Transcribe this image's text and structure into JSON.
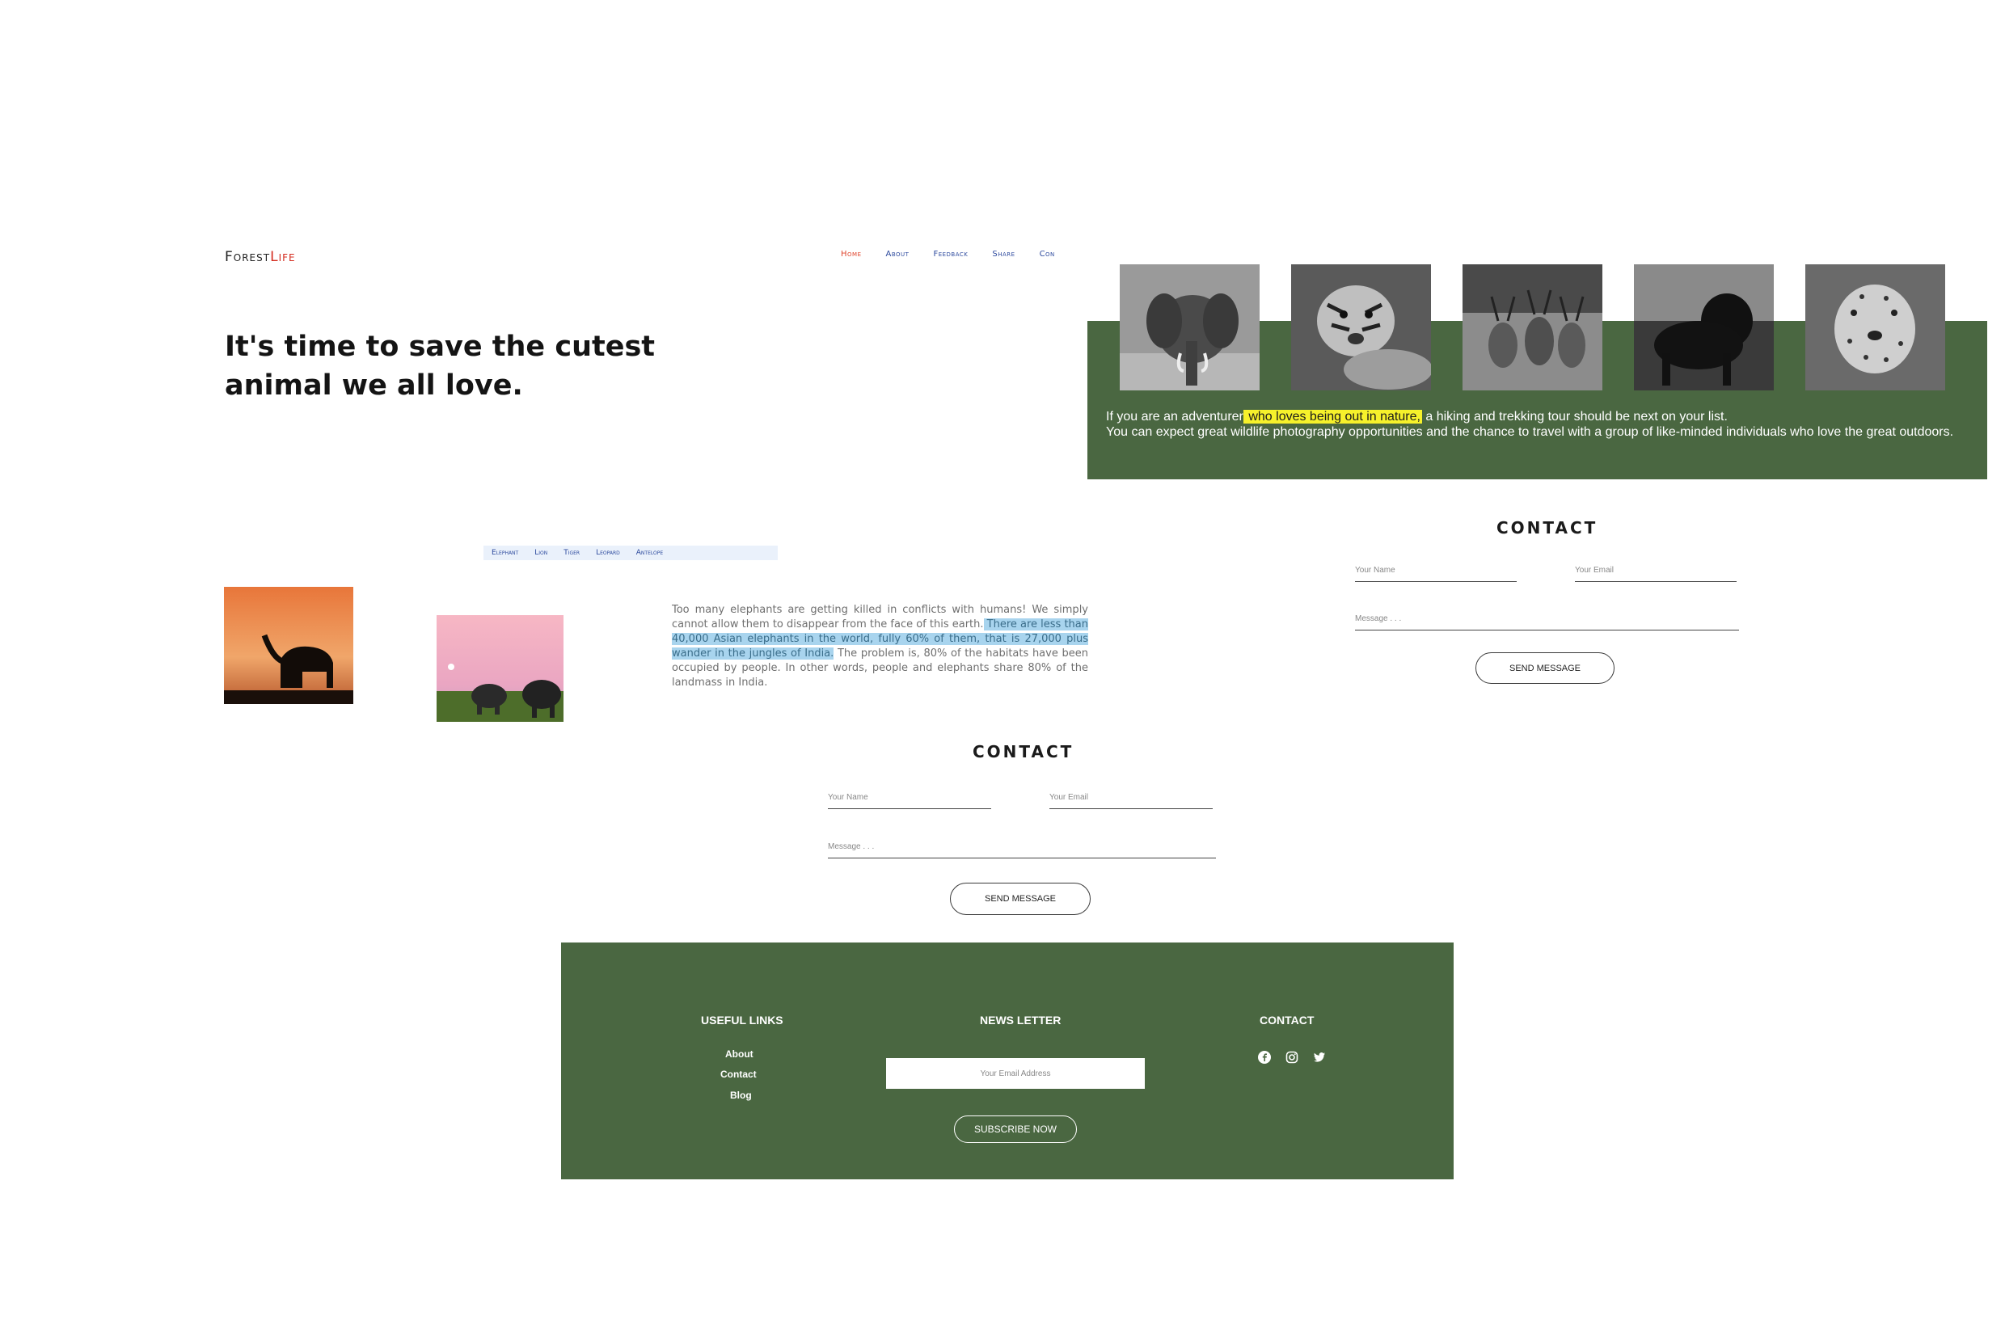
{
  "header": {
    "logo_main": "Forest",
    "logo_accent": "Life",
    "nav": [
      "Home",
      "About",
      "Feedback",
      "Share",
      "Con"
    ],
    "hero_title": "It's time to save the cutest animal we all love."
  },
  "gallery": {
    "images": [
      "elephant",
      "tiger",
      "antelopes",
      "lion",
      "leopard"
    ],
    "text_before": "If you are an adventurer",
    "text_highlight": " who loves being out in nature,",
    "text_after": " a hiking and trekking tour should be next on your list.",
    "text_line2": "You can expect great wildlife photography opportunities and the chance to travel with a group of like-minded individuals who love the great outdoors."
  },
  "tabs": [
    "Elephant",
    "Lion",
    "Tiger",
    "Leopard",
    "Antelope"
  ],
  "article": {
    "part1": "Too many elephants are getting killed in conflicts with humans! We simply cannot allow them to disappear from the face of this earth.",
    "selected": " There are less than 40,000 Asian elephants in the world, fully 60% of them, that is 27,000 plus wander in the jungles of India.",
    "part2": " The problem is, 80% of the habitats have been occupied by people. In other words, people and elephants share 80% of the landmass in India."
  },
  "contact_right": {
    "title": "CONTACT",
    "name_placeholder": "Your Name",
    "email_placeholder": "Your Email",
    "message_placeholder": "Message . . .",
    "button": "SEND MESSAGE"
  },
  "contact_center": {
    "title": "CONTACT",
    "name_placeholder": "Your Name",
    "email_placeholder": "Your Email",
    "message_placeholder": "Message . . .",
    "button": "SEND MESSAGE"
  },
  "footer": {
    "useful_links_title": "USEFUL LINKS",
    "links": [
      "About",
      "Contact",
      "Blog"
    ],
    "newsletter_title": "NEWS LETTER",
    "email_placeholder": "Your Email Address",
    "subscribe": "SUBSCRIBE NOW",
    "contact_title": "CONTACT",
    "social": [
      "facebook-icon",
      "instagram-icon",
      "twitter-icon"
    ]
  },
  "colors": {
    "green": "#4a6741",
    "accent_red": "#d42b1e",
    "nav_blue": "#2d4a9e",
    "highlight_yellow": "#f6f12b",
    "selection_blue": "#a8d4ee"
  }
}
